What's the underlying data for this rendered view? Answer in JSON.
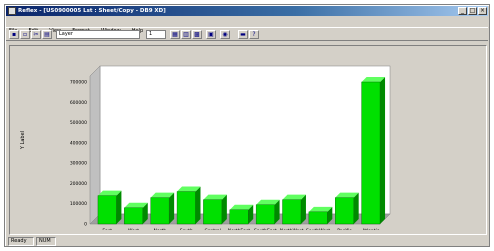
{
  "window": {
    "title": "Reflex - [US0900005 Lst : Sheet/Copy - DB9 XD]",
    "controls": [
      "_",
      "□",
      "×"
    ]
  },
  "menu": [
    "File",
    "Edit",
    "View",
    "Format",
    "Window",
    "Help"
  ],
  "toolbar": {
    "buttons_left": [
      "save-icon",
      "print-icon",
      "cut-icon",
      "copy-icon"
    ],
    "combo_value": "Layer",
    "page_value": "1",
    "buttons_right": [
      "chart-icon",
      "table-icon",
      "grid-icon",
      "legend-icon",
      "zoom-icon",
      "ruler-icon",
      "help-icon"
    ]
  },
  "chart_data": {
    "type": "bar",
    "style": "3d",
    "title": "",
    "xlabel": "X Label",
    "ylabel": "Y Label",
    "categories": [
      "East",
      "West",
      "North",
      "South",
      "Central",
      "NorthEast",
      "SouthEast",
      "NorthWest",
      "SouthWest",
      "Pacific",
      "Atlantic"
    ],
    "values": [
      140000,
      80000,
      130000,
      160000,
      120000,
      70000,
      95000,
      120000,
      60000,
      130000,
      700000
    ],
    "ylim": [
      0,
      700000
    ],
    "yticks": [
      "700000",
      "600000",
      "500000",
      "400000",
      "300000",
      "200000",
      "100000",
      "0"
    ],
    "bar_color": "#00e000",
    "plot_background": "#ffffff",
    "grid": false
  },
  "status": {
    "left": "Ready",
    "middle": "NUM"
  }
}
